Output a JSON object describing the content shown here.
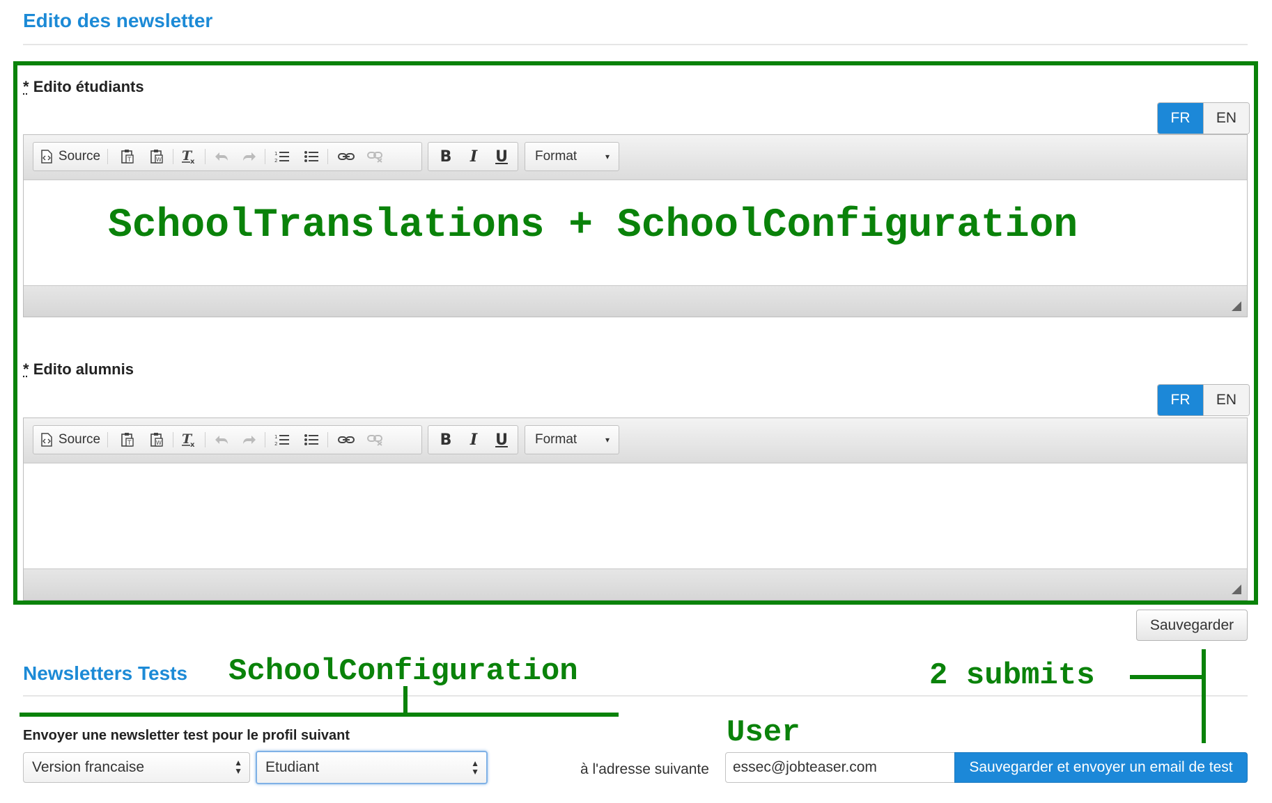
{
  "header": {
    "title": "Edito des newsletter"
  },
  "editors": [
    {
      "label": "Edito étudiants",
      "required_marker": "*",
      "lang_fr": "FR",
      "lang_en": "EN",
      "toolbar": {
        "source_label": "Source",
        "format_label": "Format"
      },
      "content_text": ""
    },
    {
      "label": "Edito alumnis",
      "required_marker": "*",
      "lang_fr": "FR",
      "lang_en": "EN",
      "toolbar": {
        "source_label": "Source",
        "format_label": "Format"
      },
      "content_text": ""
    }
  ],
  "save_button": "Sauvegarder",
  "tests_section": {
    "title": "Newsletters Tests",
    "profile_label": "Envoyer une newsletter test pour le profil suivant",
    "version_select": "Version francaise",
    "profile_select": "Etudiant",
    "address_label": "à l'adresse suivante",
    "email_value": "essec@jobteaser.com",
    "submit_button": "Sauvegarder et envoyer un email de test"
  },
  "annotations": {
    "editor_overlay": "SchoolTranslations + SchoolConfiguration",
    "config": "SchoolConfiguration",
    "submits": "2 submits",
    "user": "User"
  },
  "colors": {
    "accent": "#1c8ad6",
    "annotation_green": "#0a820a"
  },
  "icons": [
    "source-icon",
    "paste-text-icon",
    "paste-word-icon",
    "remove-format-icon",
    "undo-icon",
    "redo-icon",
    "numbered-list-icon",
    "bulleted-list-icon",
    "link-icon",
    "unlink-icon",
    "bold-icon",
    "italic-icon",
    "underline-icon",
    "dropdown-caret-icon",
    "resize-handle-icon"
  ]
}
